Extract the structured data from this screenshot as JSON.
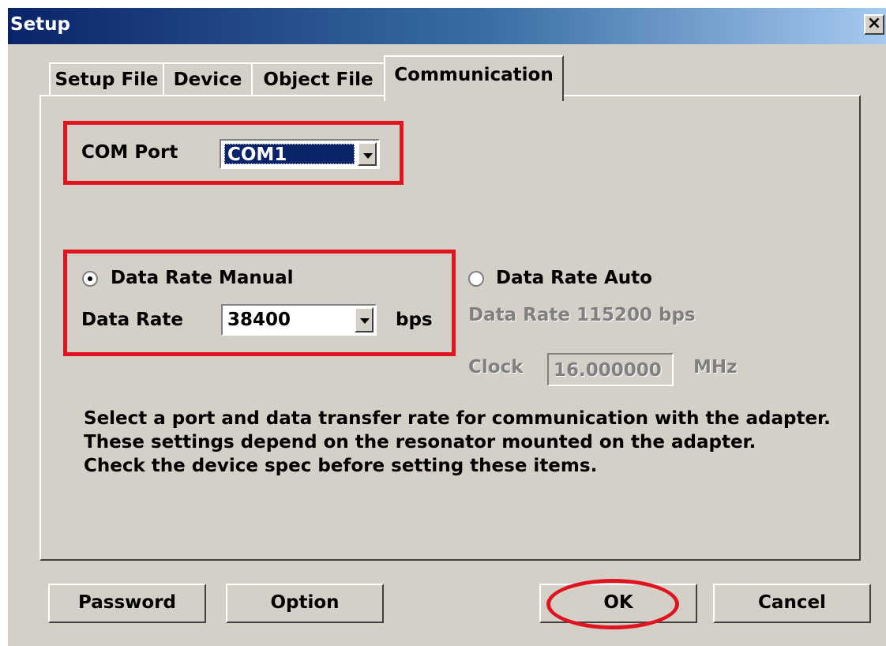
{
  "window": {
    "title": "Setup",
    "close_label": "×"
  },
  "tabs": [
    {
      "label": "Setup File",
      "active": false
    },
    {
      "label": "Device",
      "active": false
    },
    {
      "label": "Object File",
      "active": false
    },
    {
      "label": "Communication",
      "active": true
    }
  ],
  "com_port": {
    "label": "COM Port",
    "value": "COM1"
  },
  "manual": {
    "radio_label": "Data Rate Manual",
    "selected": true,
    "rate_label": "Data Rate",
    "rate_value": "38400",
    "unit": "bps"
  },
  "auto": {
    "radio_label": "Data Rate Auto",
    "selected": false,
    "rate_text": "Data Rate 115200 bps",
    "clock_label": "Clock",
    "clock_value": "16.000000",
    "clock_unit": "MHz"
  },
  "instructions": [
    "Select a port and data transfer rate for communication with the adapter.",
    "These settings depend on the resonator mounted on the adapter.",
    "Check the device spec before setting these items."
  ],
  "buttons": {
    "password": "Password",
    "option": "Option",
    "ok": "OK",
    "cancel": "Cancel"
  },
  "colors": {
    "annotation": "#e0141e",
    "selection": "#0a246a",
    "face": "#d4d0c8"
  }
}
